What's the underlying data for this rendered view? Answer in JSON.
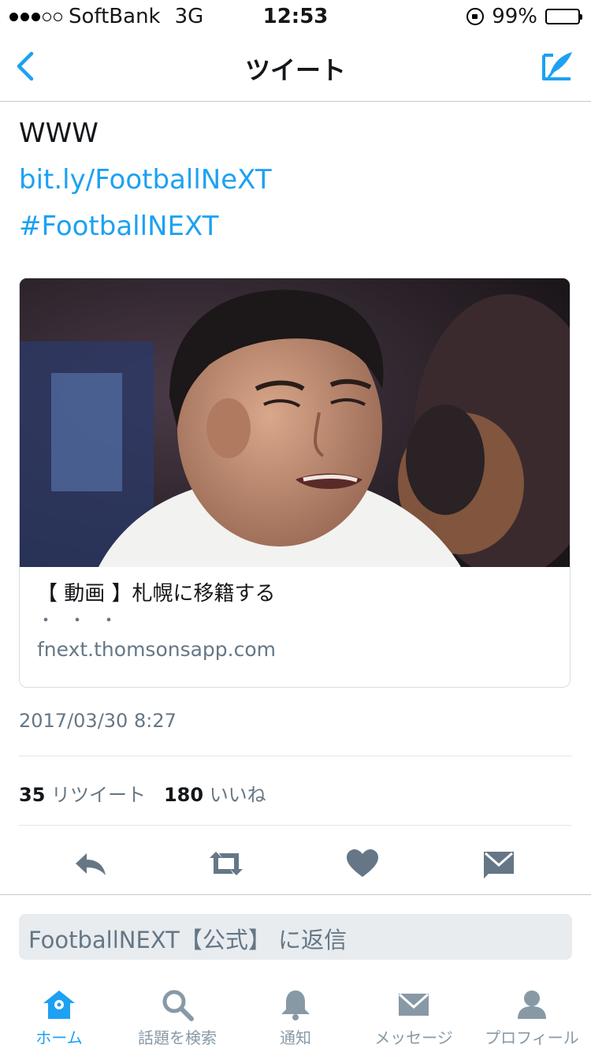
{
  "status_bar": {
    "carrier": "SoftBank",
    "network": "3G",
    "time": "12:53",
    "battery": "99%",
    "signal_bars_filled": 3,
    "signal_bars_total": 5
  },
  "nav": {
    "title": "ツイート",
    "back_icon": "chevron-left-icon",
    "compose_icon": "compose-tweet-icon"
  },
  "tweet": {
    "text": "WWW",
    "link": "bit.ly/FootballNeXT",
    "hashtag": "#FootballNEXT",
    "card": {
      "title": "【 動画 】札幌に移籍する",
      "description": "・・・",
      "url": "fnext.thomsonsapp.com"
    },
    "timestamp": "2017/03/30 8:27",
    "retweet_count": "35",
    "retweet_label": "リツイート",
    "like_count": "180",
    "like_label": "いいね"
  },
  "actions": [
    "reply-icon",
    "retweet-icon",
    "like-icon",
    "message-icon"
  ],
  "reply": {
    "placeholder": "FootballNEXT【公式】 に返信"
  },
  "tabs": [
    {
      "label": "ホーム",
      "icon": "home-icon",
      "active": true
    },
    {
      "label": "話題を検索",
      "icon": "search-icon",
      "active": false
    },
    {
      "label": "通知",
      "icon": "bell-icon",
      "active": false
    },
    {
      "label": "メッセージ",
      "icon": "envelope-icon",
      "active": false
    },
    {
      "label": "プロフィール",
      "icon": "person-icon",
      "active": false
    }
  ],
  "colors": {
    "accent": "#1da1f2",
    "secondary_text": "#657786",
    "icon_gray": "#8899a6"
  }
}
